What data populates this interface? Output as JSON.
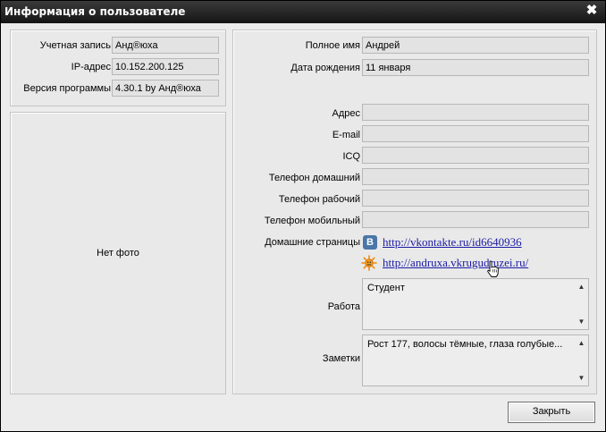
{
  "window": {
    "title": "Информация о пользователе",
    "close_glyph": "✖"
  },
  "account": {
    "account_label": "Учетная запись",
    "account_value": "Анд®юха",
    "ip_label": "IP-адрес",
    "ip_value": "10.152.200.125",
    "version_label": "Версия программы",
    "version_value": "4.30.1 by Анд®юха"
  },
  "photo": {
    "placeholder": "Нет фото"
  },
  "profile": {
    "fullname_label": "Полное имя",
    "fullname_value": "Андрей",
    "birthdate_label": "Дата рождения",
    "birthdate_value": "11 января",
    "address_label": "Адрес",
    "address_value": "",
    "email_label": "E-mail",
    "email_value": "",
    "icq_label": "ICQ",
    "icq_value": "",
    "home_phone_label": "Телефон домашний",
    "home_phone_value": "",
    "work_phone_label": "Телефон рабочий",
    "work_phone_value": "",
    "mobile_phone_label": "Телефон мобильный",
    "mobile_phone_value": "",
    "homepages_label": "Домашние страницы",
    "homepages": [
      {
        "icon": "vk-icon",
        "icon_glyph": "B",
        "url": "http://vkontakte.ru/id6640936"
      },
      {
        "icon": "sun-icon",
        "url": "http://andruxa.vkrugudruzei.ru/"
      }
    ],
    "work_label": "Работа",
    "work_value": "Студент",
    "notes_label": "Заметки",
    "notes_value": "Рост 177, волосы тёмные, глаза голубые..."
  },
  "footer": {
    "close_button": "Закрыть"
  },
  "colors": {
    "titlebar": "#151515",
    "link": "#1a1aa6",
    "vk_brand": "#4a76a8",
    "sun_icon": "#f08a00"
  }
}
